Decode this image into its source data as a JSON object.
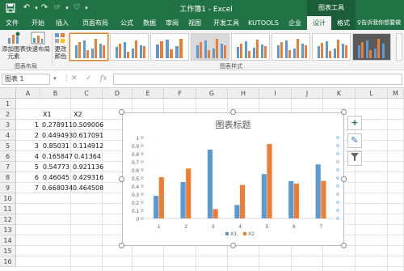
{
  "titlebar": {
    "title": "工作簿1 - Excel",
    "context_title": "图表工具",
    "quick_access": [
      "save-icon",
      "undo-icon",
      "redo-icon",
      "touch-mode-icon",
      "customize-icon"
    ]
  },
  "tabs": [
    {
      "label": "文件",
      "active": false
    },
    {
      "label": "开始",
      "active": false
    },
    {
      "label": "插入",
      "active": false
    },
    {
      "label": "页面布局",
      "active": false
    },
    {
      "label": "公式",
      "active": false
    },
    {
      "label": "数据",
      "active": false
    },
    {
      "label": "审阅",
      "active": false
    },
    {
      "label": "视图",
      "active": false
    },
    {
      "label": "开发工具",
      "active": false
    },
    {
      "label": "KUTOOLS",
      "active": false
    },
    {
      "label": "企业",
      "active": false
    },
    {
      "label": "设计",
      "active": true
    },
    {
      "label": "格式",
      "active": false
    }
  ],
  "tell_me": "告诉我你想要做",
  "ribbon": {
    "add_element": "添加图表\n元素",
    "quick_layout": "快速布局",
    "change_colors": "更改\n颜色",
    "group_layouts": "图表布局",
    "group_styles": "图表样式"
  },
  "formula_bar": {
    "name_box": "图表 1",
    "cancel": "✕",
    "enter": "✓",
    "fx": "fx",
    "value": ""
  },
  "columns": [
    "A",
    "B",
    "C",
    "D",
    "E",
    "F",
    "G",
    "H",
    "I",
    "J",
    "K",
    "L",
    "M"
  ],
  "rows": [
    "1",
    "2",
    "3",
    "4",
    "5",
    "6",
    "7",
    "8",
    "9",
    "10",
    "11",
    "12",
    "13",
    "14",
    "15",
    "16"
  ],
  "sheet": {
    "header_x1": "X1",
    "header_x2": "X2",
    "data": [
      {
        "a": "1",
        "b": "0.278911",
        "c": "0.509006"
      },
      {
        "a": "2",
        "b": "0.449493",
        "c": "0.617091"
      },
      {
        "a": "3",
        "b": "0.85031",
        "c": "0.114912"
      },
      {
        "a": "4",
        "b": "0.165847",
        "c": "0.41364"
      },
      {
        "a": "5",
        "b": "0.54773",
        "c": "0.921136"
      },
      {
        "a": "6",
        "b": "0.46045",
        "c": "0.429316"
      },
      {
        "a": "7",
        "b": "0.668034",
        "c": "0.464508"
      }
    ]
  },
  "side_buttons": [
    "plus-icon",
    "brush-icon",
    "filter-icon"
  ],
  "colors": {
    "x1": "#5b9bd5",
    "x2": "#ed7d31",
    "excel_green": "#217346"
  },
  "chart_data": {
    "type": "bar",
    "title": "图表标题",
    "categories": [
      "1",
      "2",
      "3",
      "4",
      "5",
      "6",
      "7"
    ],
    "series": [
      {
        "name": "X1",
        "values": [
          0.278911,
          0.449493,
          0.85031,
          0.165847,
          0.54773,
          0.46045,
          0.668034
        ]
      },
      {
        "name": "X2",
        "values": [
          0.509006,
          0.617091,
          0.114912,
          0.41364,
          0.921136,
          0.429316,
          0.464508
        ]
      }
    ],
    "ylim": [
      0,
      1
    ],
    "yticks": [
      "0",
      "0.1",
      "0.2",
      "0.3",
      "0.4",
      "0.5",
      "0.6",
      "0.7",
      "0.8",
      "0.9",
      "1"
    ],
    "legend": "bottom",
    "grid": false
  }
}
